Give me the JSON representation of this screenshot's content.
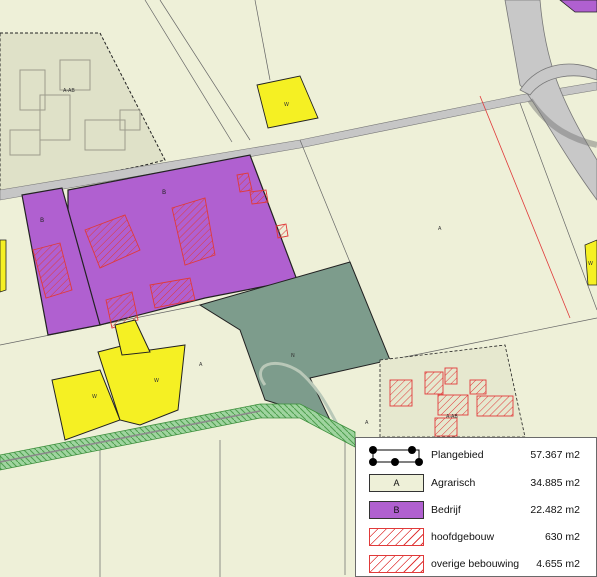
{
  "colors": {
    "agrarisch": "#eef0d8",
    "bedrijf": "#b060d0",
    "wonen": "#f5f023",
    "natuur": "#7d9c8c",
    "hatch": "#e03a3a",
    "road": "#bfbfbf",
    "green_strip": "#8ccc8c"
  },
  "map": {
    "zone_labels": {
      "a_top_left": "A-AB",
      "a_right": "A",
      "a_bottom": "A",
      "a_bottom_right": "A",
      "a_ab_bottom": "A-AB",
      "b_left": "B",
      "b_main": "B",
      "w_top": "W",
      "w_left": "W",
      "w_mid": "W",
      "w_right": "W",
      "n_green": "N"
    }
  },
  "legend": {
    "items": [
      {
        "icon": "plangebied-symbol",
        "symbol_text": "",
        "label": "Plangebied",
        "value": "57.367 m2"
      },
      {
        "icon": "agrarisch-symbol",
        "symbol_text": "A",
        "label": "Agrarisch",
        "value": "34.885 m2"
      },
      {
        "icon": "bedrijf-symbol",
        "symbol_text": "B",
        "label": "Bedrijf",
        "value": "22.482 m2"
      },
      {
        "icon": "hoofdgebouw-hatch-symbol",
        "symbol_text": "",
        "label": "hoofdgebouw",
        "value": "630 m2"
      },
      {
        "icon": "overige-bebouwing-hatch-symbol",
        "symbol_text": "",
        "label": "overige bebouwing",
        "value": "4.655 m2"
      }
    ]
  }
}
